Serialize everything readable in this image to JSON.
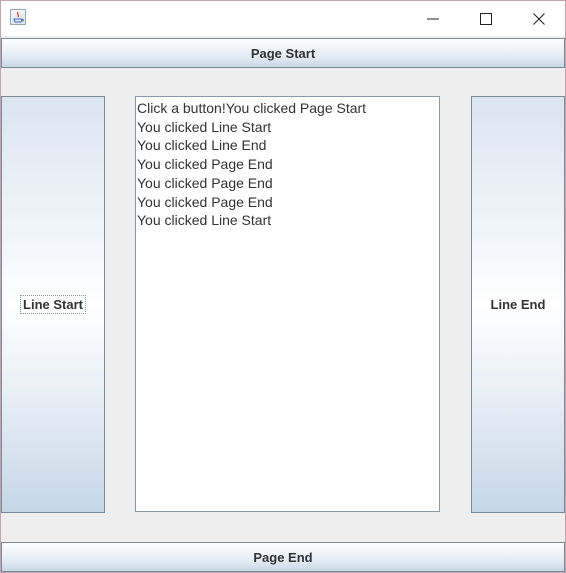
{
  "window": {
    "title": "",
    "icons": {
      "app": "java-icon",
      "minimize": "minimize-icon",
      "maximize": "maximize-icon",
      "close": "close-icon"
    }
  },
  "buttons": {
    "page_start": "Page Start",
    "line_start": "Line Start",
    "line_end": "Line End",
    "page_end": "Page End"
  },
  "log": {
    "lines": [
      "Click a button!You clicked Page Start",
      "You clicked Line Start",
      "You clicked Line End",
      "You clicked Page End",
      "You clicked Page End",
      "You clicked Page End",
      "You clicked Line Start"
    ]
  },
  "colors": {
    "button_gradient_top": "#ffffff",
    "button_gradient_bottom": "#c8d7e6",
    "button_border": "#7a8a99",
    "text": "#333333"
  }
}
